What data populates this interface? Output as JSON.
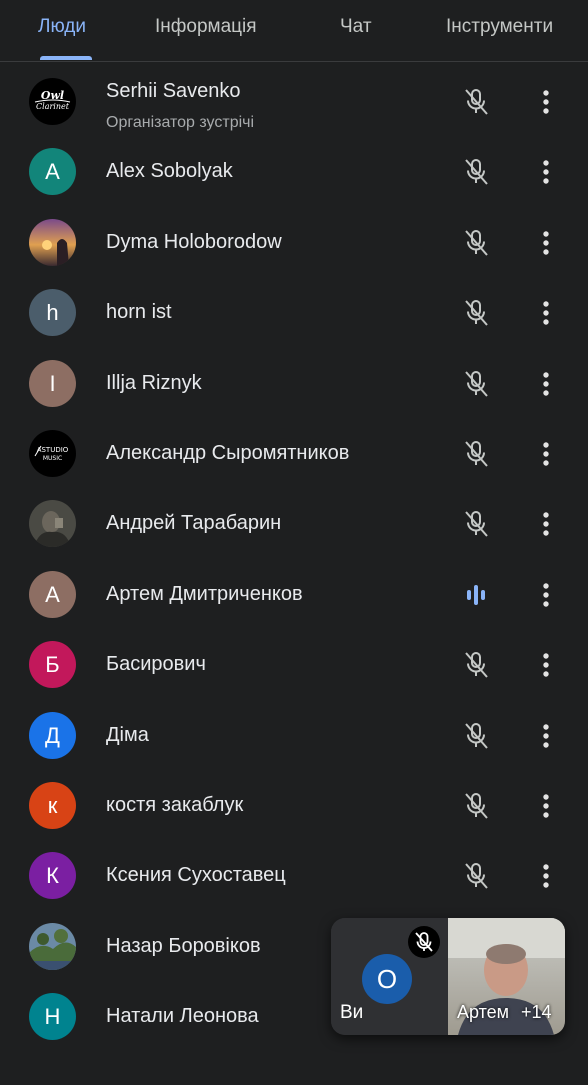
{
  "tabs": [
    {
      "label": "Люди"
    },
    {
      "label": "Інформація"
    },
    {
      "label": "Чат"
    },
    {
      "label": "Інструменти"
    }
  ],
  "participants": [
    {
      "name": "Serhii Savenko",
      "subtitle": "Організатор зустрічі",
      "initial": "",
      "avatar": "owl-clarinet-logo",
      "avatar_text": "Owl Clarinet",
      "mic": "muted"
    },
    {
      "name": "Alex Sobolyak",
      "initial": "A",
      "color": "#12857a",
      "mic": "muted"
    },
    {
      "name": "Dyma Holoborodow",
      "initial": "",
      "avatar": "photo-sunset",
      "mic": "muted"
    },
    {
      "name": "horn ist",
      "initial": "h",
      "color": "#4b5d6b",
      "mic": "muted"
    },
    {
      "name": "Illja Riznyk",
      "initial": "I",
      "color": "#8d6e63",
      "mic": "muted"
    },
    {
      "name": "Александр Сыромятников",
      "initial": "",
      "avatar": "astudio-music-logo",
      "avatar_text": "ASTUDIO MUSIC",
      "mic": "muted"
    },
    {
      "name": "Андрей Тарабарин",
      "initial": "",
      "avatar": "photo-portrait",
      "mic": "muted"
    },
    {
      "name": "Артем Дмитриченков",
      "initial": "A",
      "color": "#8d6e63",
      "mic": "speaking"
    },
    {
      "name": "Басирович",
      "initial": "Б",
      "color": "#c2185b",
      "mic": "muted"
    },
    {
      "name": "Діма",
      "initial": "Д",
      "color": "#1a73e8",
      "mic": "muted"
    },
    {
      "name": "костя закаблук",
      "initial": "к",
      "color": "#d84315",
      "mic": "muted"
    },
    {
      "name": "Ксения Сухоставец",
      "initial": "К",
      "color": "#7b1fa2",
      "mic": "muted"
    },
    {
      "name": "Назар Боровіков",
      "initial": "",
      "avatar": "photo-landscape",
      "mic": "muted"
    },
    {
      "name": "Натали Леонова",
      "initial": "Н",
      "color": "#00838f",
      "mic": "muted"
    }
  ],
  "pip": {
    "self_initial": "O",
    "self_label": "Ви",
    "speaker_label": "Артем",
    "more_count": "+14"
  },
  "colors": {
    "background": "#1e1f20",
    "accent": "#8ab4f8",
    "text": "#e8eaed"
  }
}
